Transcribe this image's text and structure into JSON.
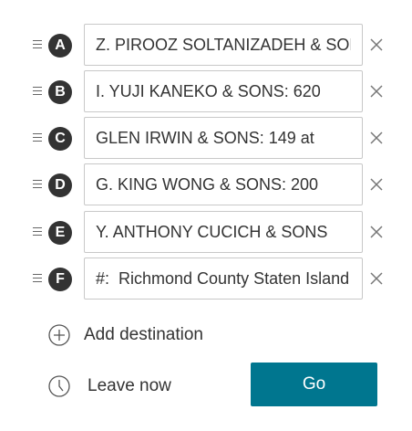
{
  "destinations": [
    {
      "marker": "A",
      "value": "Z. PIROOZ SOLTANIZADEH & SONS"
    },
    {
      "marker": "B",
      "value": "I. YUJI KANEKO & SONS: 620"
    },
    {
      "marker": "C",
      "value": "GLEN IRWIN & SONS: 149 at"
    },
    {
      "marker": "D",
      "value": "G. KING WONG & SONS: 200"
    },
    {
      "marker": "E",
      "value": "Y. ANTHONY CUCICH & SONS"
    },
    {
      "marker": "F",
      "value": "#:  Richmond County Staten Island"
    }
  ],
  "add_destination": {
    "label": "Add destination",
    "icon": "plus-circle-icon"
  },
  "leave": {
    "label": "Leave now",
    "icon": "clock-icon"
  },
  "go": {
    "label": "Go"
  },
  "colors": {
    "marker_bg": "#333333",
    "go_bg": "#00768f",
    "border": "#c8c8c8"
  }
}
